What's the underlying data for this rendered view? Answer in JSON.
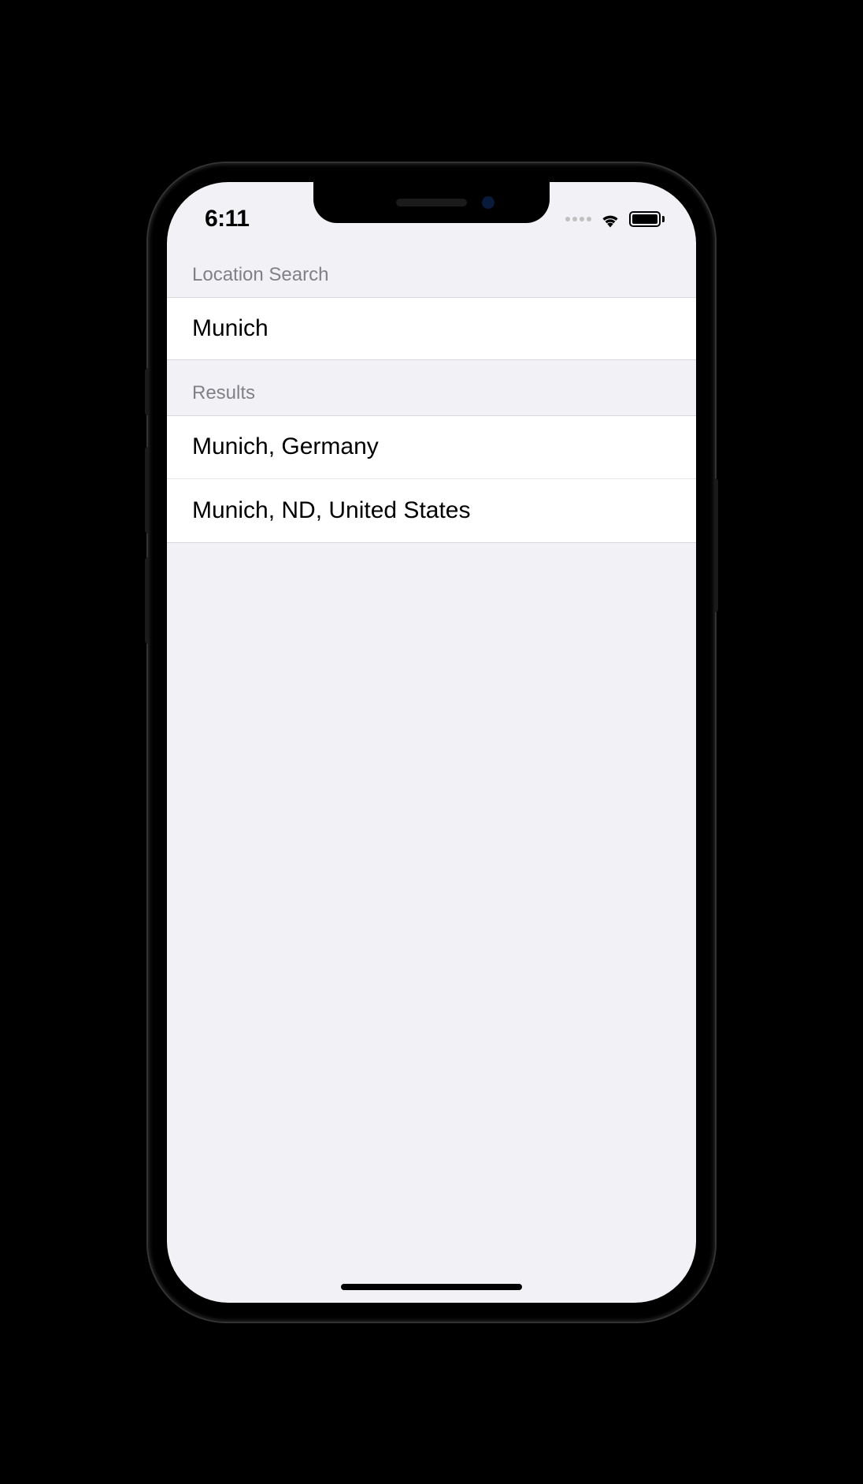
{
  "status_bar": {
    "time": "6:11"
  },
  "sections": {
    "search_header": "Location Search",
    "results_header": "Results"
  },
  "search": {
    "value": "Munich"
  },
  "results": [
    {
      "label": "Munich, Germany"
    },
    {
      "label": "Munich, ND, United States"
    }
  ]
}
